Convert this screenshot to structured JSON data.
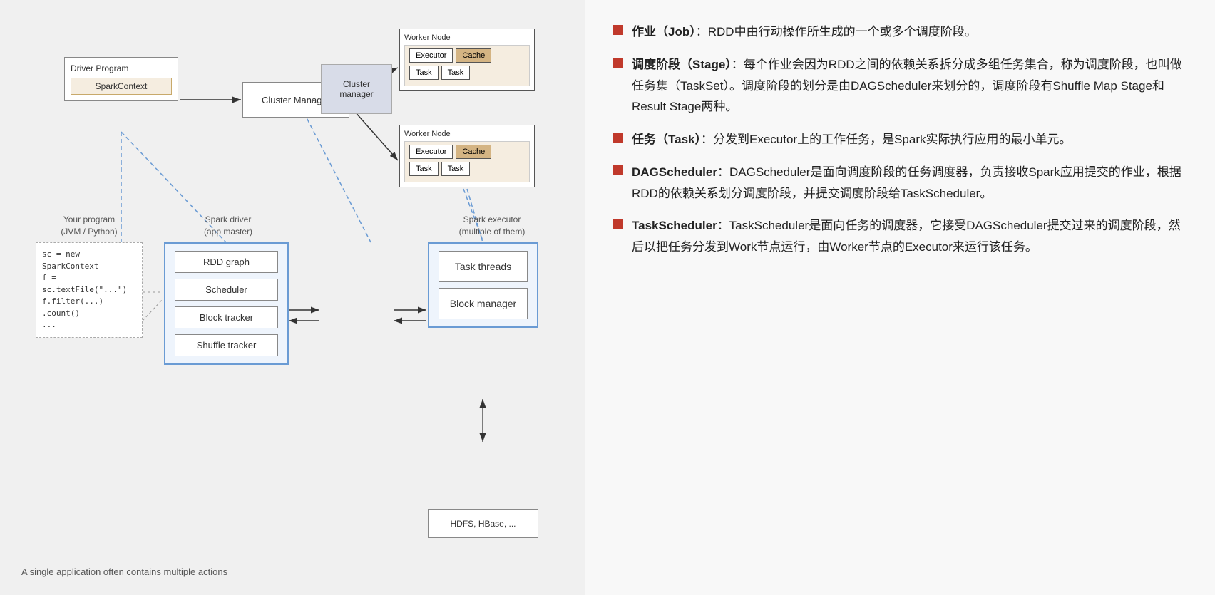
{
  "diagram": {
    "worker_node_label": "Worker Node",
    "executor_label": "Executor",
    "cache_label": "Cache",
    "task_label": "Task",
    "driver_program_label": "Driver Program",
    "spark_context_label": "SparkContext",
    "cluster_manager_label": "Cluster Manager",
    "your_program_label": "Your program\n(JVM / Python)",
    "spark_driver_label": "Spark driver\n(app master)",
    "spark_executor_label": "Spark executor\n(multiple of them)",
    "rdd_graph_label": "RDD graph",
    "scheduler_label": "Scheduler",
    "block_tracker_label": "Block tracker",
    "shuffle_tracker_label": "Shuffle tracker",
    "cluster_manager_mid_label": "Cluster\nmanager",
    "task_threads_label": "Task\nthreads",
    "block_manager_label": "Block\nmanager",
    "hdfs_label": "HDFS, HBase, ...",
    "code_line1": "sc = new SparkContext",
    "code_line2": "f = sc.textFile(\"...\")",
    "code_line3": "f.filter(...)",
    "code_line4": ".count()",
    "code_line5": "...",
    "bottom_note": "A single application often contains multiple actions"
  },
  "bullets": [
    {
      "bold": "作业（Job）",
      "text": "：RDD中由行动操作所生成的一个或多个调度阶段。"
    },
    {
      "bold": "调度阶段（Stage）",
      "text": "：每个作业会因为RDD之间的依赖关系拆分成多组任务集合，称为调度阶段，也叫做任务集（TaskSet）。调度阶段的划分是由DAGScheduler来划分的，调度阶段有Shuffle Map Stage和Result Stage两种。"
    },
    {
      "bold": "任务（Task）",
      "text": "：分发到Executor上的工作任务，是Spark实际执行应用的最小单元。"
    },
    {
      "bold": "DAGScheduler",
      "text": "：DAGScheduler是面向调度阶段的任务调度器，负责接收Spark应用提交的作业，根据RDD的依赖关系划分调度阶段，并提交调度阶段给TaskScheduler。"
    },
    {
      "bold": "TaskScheduler",
      "text": "：TaskScheduler是面向任务的调度器，它接受DAGScheduler提交过来的调度阶段，然后以把任务分发到Work节点运行，由Worker节点的Executor来运行该任务。"
    }
  ]
}
